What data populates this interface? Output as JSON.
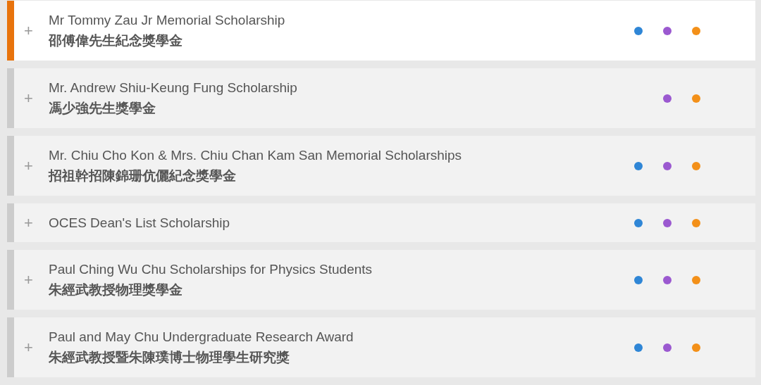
{
  "scholarships": [
    {
      "title": "Mr Tommy Zau Jr Memorial Scholarship",
      "title_zh": "邵傅偉先生紀念獎學金",
      "selected": true,
      "expand_icon": "+",
      "dots": [
        {
          "color": "#2f86d6"
        },
        {
          "color": "#9b59d0"
        },
        {
          "color": "#f39019"
        }
      ]
    },
    {
      "title": "Mr. Andrew Shiu-Keung Fung Scholarship",
      "title_zh": "馮少強先生獎學金",
      "selected": false,
      "expand_icon": "+",
      "dots": [
        {
          "color": "#9b59d0"
        },
        {
          "color": "#f39019"
        }
      ]
    },
    {
      "title": "Mr. Chiu Cho Kon & Mrs. Chiu Chan Kam San Memorial Scholarships",
      "title_zh": "招祖幹招陳錦珊伉儷紀念獎學金",
      "selected": false,
      "expand_icon": "+",
      "dots": [
        {
          "color": "#2f86d6"
        },
        {
          "color": "#9b59d0"
        },
        {
          "color": "#f39019"
        }
      ]
    },
    {
      "title": "OCES Dean's List Scholarship",
      "selected": false,
      "expand_icon": "+",
      "dots": [
        {
          "color": "#2f86d6"
        },
        {
          "color": "#9b59d0"
        },
        {
          "color": "#f39019"
        }
      ]
    },
    {
      "title": "Paul Ching Wu Chu Scholarships for Physics Students",
      "title_zh": "朱經武教授物理獎學金",
      "selected": false,
      "expand_icon": "+",
      "dots": [
        {
          "color": "#2f86d6"
        },
        {
          "color": "#9b59d0"
        },
        {
          "color": "#f39019"
        }
      ]
    },
    {
      "title": "Paul and May Chu Undergraduate Research Award",
      "title_zh": "朱經武教授暨朱陳璞博士物理學生研究獎",
      "selected": false,
      "expand_icon": "+",
      "dots": [
        {
          "color": "#2f86d6"
        },
        {
          "color": "#9b59d0"
        },
        {
          "color": "#f39019"
        }
      ]
    }
  ]
}
